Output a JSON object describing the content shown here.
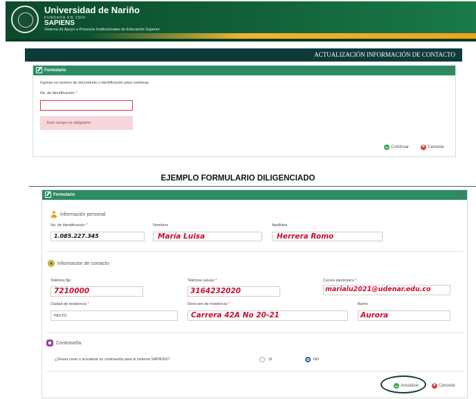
{
  "header": {
    "university": "Universidad de Nariño",
    "founded": "FUNDADA EN 1904",
    "app_name": "SAPIENS",
    "app_subtitle": "Sistema de Apoyo a Procesos Institucionales de Educación Superior"
  },
  "page_title": "ACTUALIZACIÓN INFORMACIÓN DE CONTACTO",
  "form1": {
    "panel_title": "Formulario",
    "instruction": "Ingrese su número de documento o identificación para continuar.",
    "id_label": "No. de identificación",
    "required_mark": "*",
    "id_value": "",
    "error_message": "Este campo es obligatorio",
    "continue_label": "Continuar",
    "cancel_label": "Cancelar"
  },
  "example_title": "EJEMPLO FORMULARIO DILIGENCIADO",
  "form2": {
    "panel_title": "Formulario",
    "personal_section": "Información personal",
    "id_label": "No. de identificación",
    "names_label": "Nombres",
    "surnames_label": "Apellidos",
    "id_value": "1.085.227.345",
    "names_value": "María Luisa",
    "surnames_value": "Herrera Romo",
    "contact_section": "Información de contacto",
    "phone_label": "Teléfono fijo",
    "mobile_label": "Teléfono celular",
    "email_label": "Correo electrónico",
    "phone_value": "7210000",
    "mobile_value": "3164232020",
    "email_value": "marialu2021@udenar.edu.co",
    "city_label": "Ciudad de residencia",
    "address_label": "Dirección de residencia",
    "neighborhood_label": "Barrio",
    "city_value": "PASTO",
    "address_value": "Carrera 42A No 20-21",
    "neighborhood_value": "Aurora",
    "password_section": "Contraseña",
    "password_question": "¿Desea crear o actualizar su contraseña para el sistema SAPIENS?",
    "option_yes": "SI",
    "option_no": "NO",
    "selected_option": "NO",
    "update_label": "Actualizar",
    "cancel_label": "Cancelar"
  }
}
